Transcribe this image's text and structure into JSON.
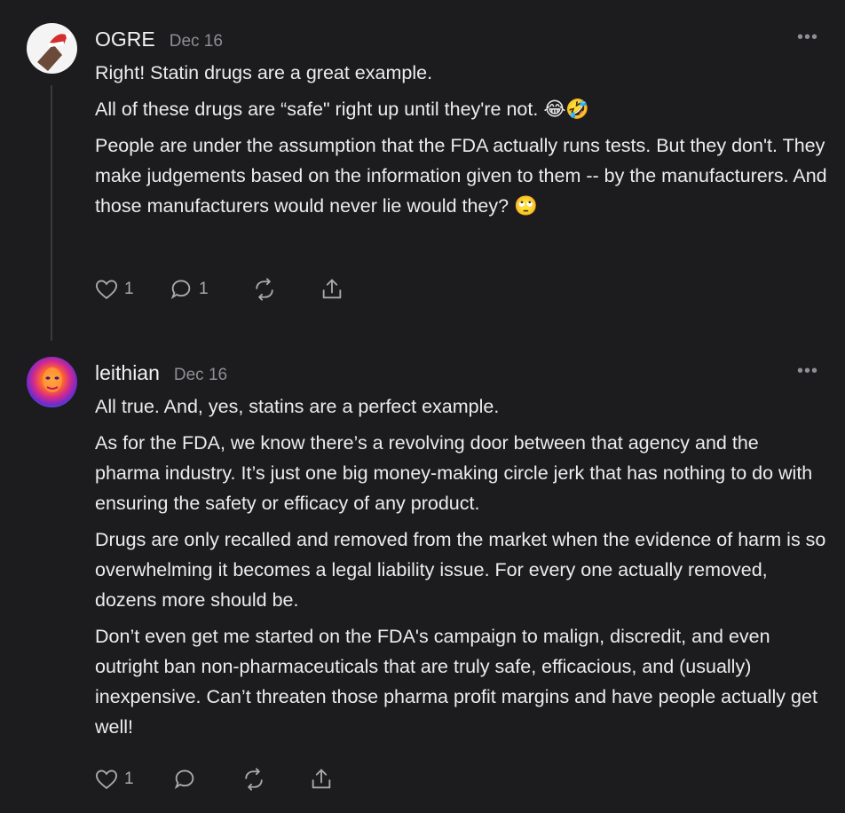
{
  "comments": [
    {
      "author": "OGRE",
      "date": "Dec 16",
      "more_label": "•••",
      "avatar_icon": "santa-hat-character-avatar",
      "paragraphs": [
        "Right! Statin drugs are a great example.",
        "All of these drugs are “safe\" right up until they're not. 😂🤣",
        "People are under the assumption that the FDA actually runs tests. But they don't. They make judgements based on the information given to them -- by the manufacturers. And those manufacturers would never lie would they? 🙄"
      ],
      "like_count": "1",
      "reply_count": "1"
    },
    {
      "author": "leithian",
      "date": "Dec 16",
      "more_label": "•••",
      "avatar_icon": "colorful-portrait-avatar",
      "paragraphs": [
        "All true. And, yes, statins are a perfect example.",
        "As for the FDA, we know there’s a revolving door between that agency and the pharma industry. It’s just one big money-making circle jerk that has nothing to do with ensuring the safety or efficacy of any product.",
        "Drugs are only recalled and removed from the market when the evidence of harm is so overwhelming it becomes a legal liability issue. For every one actually removed, dozens more should be.",
        "Don’t even get me started on the FDA's campaign to malign, discredit, and even outright ban non-pharmaceuticals that are truly safe, efficacious, and (usually) inexpensive. Can’t threaten those pharma profit margins and have people actually get well!"
      ],
      "like_count": "1",
      "reply_count": ""
    }
  ],
  "colors": {
    "background": "#1c1c1e",
    "text": "#ececec",
    "muted": "#8e8e93",
    "thread_line": "#3a3a3c"
  }
}
